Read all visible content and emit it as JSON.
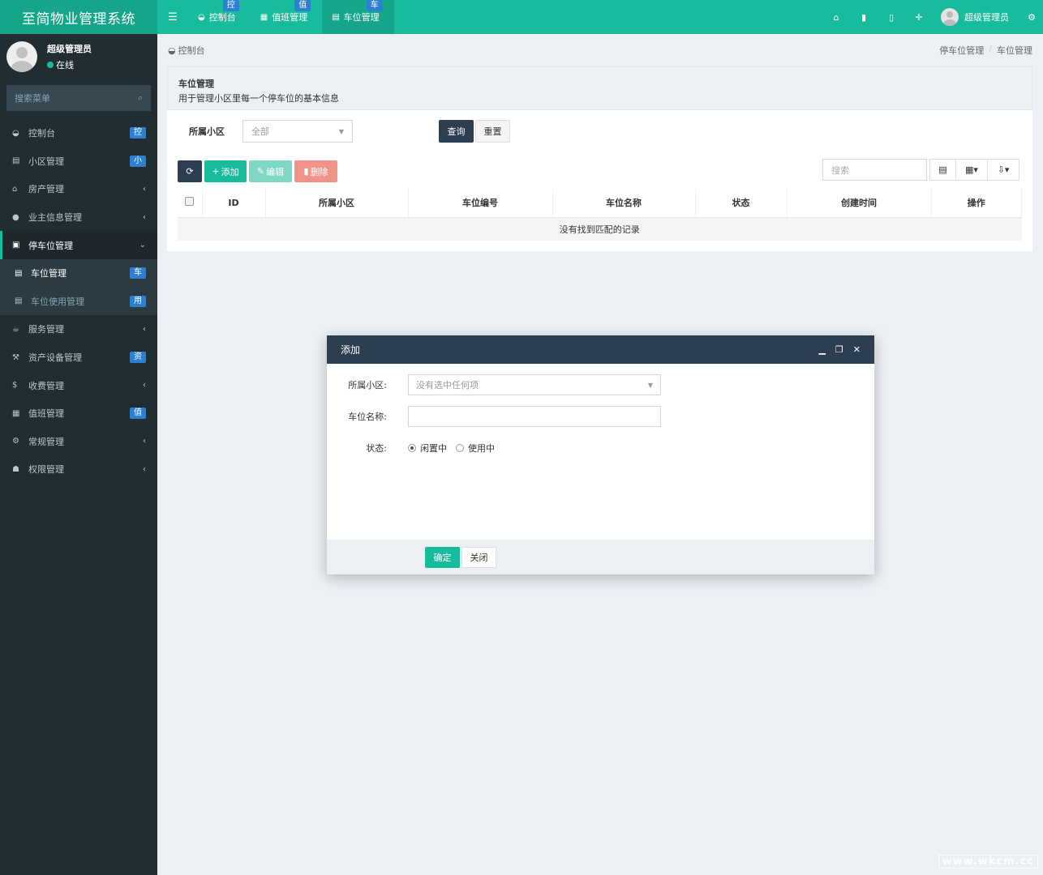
{
  "header": {
    "brand": "至简物业管理系统",
    "tabs": [
      {
        "label": "控制台",
        "badge": "控",
        "icon": "dashboard-icon"
      },
      {
        "label": "值班管理",
        "badge": "值",
        "icon": "calendar-icon"
      },
      {
        "label": "车位管理",
        "badge": "车",
        "icon": "table-icon"
      }
    ],
    "user_name": "超级管理员"
  },
  "sidebar": {
    "user_name": "超级管理员",
    "status": "在线",
    "search_placeholder": "搜索菜单",
    "items": [
      {
        "label": "控制台",
        "badge": "控"
      },
      {
        "label": "小区管理",
        "badge": "小"
      },
      {
        "label": "房产管理",
        "arrow": "‹"
      },
      {
        "label": "业主信息管理",
        "arrow": "‹"
      },
      {
        "label": "停车位管理",
        "arrow": "⌄"
      },
      {
        "label": "车位管理",
        "badge": "车"
      },
      {
        "label": "车位使用管理",
        "badge": "用"
      },
      {
        "label": "服务管理",
        "arrow": "‹"
      },
      {
        "label": "资产设备管理",
        "badge": "资"
      },
      {
        "label": "收费管理",
        "arrow": "‹"
      },
      {
        "label": "值班管理",
        "badge": "值"
      },
      {
        "label": "常规管理",
        "arrow": "‹"
      },
      {
        "label": "权限管理",
        "arrow": "‹"
      }
    ]
  },
  "breadcrumb": {
    "home": "控制台",
    "path": [
      "停车位管理",
      "车位管理"
    ],
    "separator": "/"
  },
  "panel": {
    "title": "车位管理",
    "description": "用于管理小区里每一个停车位的基本信息",
    "filter_label": "所属小区",
    "filter_value": "全部",
    "query_label": "查询",
    "reset_label": "重置"
  },
  "toolbar": {
    "add_label": "添加",
    "edit_label": "编辑",
    "delete_label": "删除",
    "search_placeholder": "搜索"
  },
  "table": {
    "columns": [
      "ID",
      "所属小区",
      "车位编号",
      "车位名称",
      "状态",
      "创建时间",
      "操作"
    ],
    "empty_text": "没有找到匹配的记录"
  },
  "modal": {
    "title": "添加",
    "fields": {
      "community_label": "所属小区:",
      "community_placeholder": "没有选中任何项",
      "name_label": "车位名称:",
      "name_value": "",
      "status_label": "状态:",
      "status_options": [
        "闲置中",
        "使用中"
      ],
      "status_selected": "闲置中"
    },
    "ok_label": "确定",
    "close_label": "关闭"
  },
  "watermark": "www.wkcm.cc",
  "colors": {
    "primary": "#18bc9c",
    "dark": "#2c3e50",
    "sidebar": "#222d32",
    "badge": "#2c7fd1",
    "danger_light": "#f0948a"
  }
}
